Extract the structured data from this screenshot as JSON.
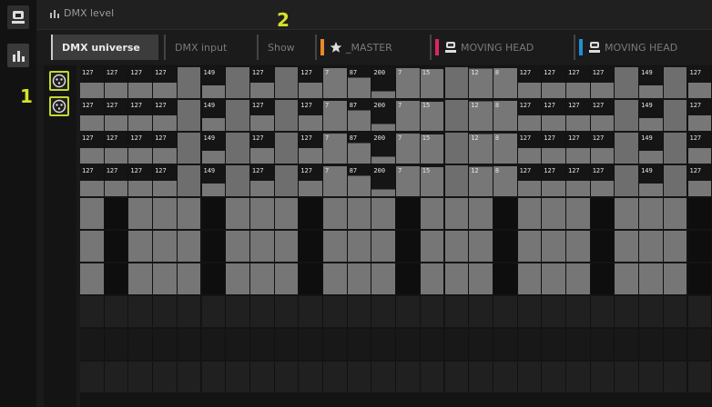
{
  "window": {
    "title": "DMX level"
  },
  "tabs": [
    {
      "label": "DMX universe",
      "active": true,
      "color": ""
    },
    {
      "label": "DMX input",
      "active": false,
      "color": ""
    },
    {
      "label": "Show",
      "active": false,
      "color": ""
    },
    {
      "label": "_MASTER",
      "active": false,
      "color": "#e8892b"
    },
    {
      "label": "MOVING HEAD",
      "active": false,
      "color": "#e0245e"
    },
    {
      "label": "MOVING HEAD",
      "active": false,
      "color": "#1f8fd6"
    }
  ],
  "callouts": {
    "devices": "1",
    "tabs": "2"
  },
  "colors": {
    "accent": "#d4e325",
    "full_level": "#1a1a1a",
    "zero_level": "#6e6e6e"
  },
  "dmx_grid": {
    "rows": [
      [
        "127",
        "127",
        "127",
        "127",
        "",
        "149",
        "",
        "127",
        "",
        "127",
        "7",
        "87",
        "200",
        "7",
        "15",
        "",
        "12",
        "8",
        "127",
        "127",
        "127",
        "127",
        "",
        "149",
        "",
        "127"
      ],
      [
        "127",
        "127",
        "127",
        "127",
        "",
        "149",
        "",
        "127",
        "",
        "127",
        "7",
        "87",
        "200",
        "7",
        "15",
        "",
        "12",
        "8",
        "127",
        "127",
        "127",
        "127",
        "",
        "149",
        "",
        "127"
      ],
      [
        "127",
        "127",
        "127",
        "127",
        "",
        "149",
        "",
        "127",
        "",
        "127",
        "7",
        "87",
        "200",
        "7",
        "15",
        "",
        "12",
        "8",
        "127",
        "127",
        "127",
        "127",
        "",
        "149",
        "",
        "127"
      ],
      [
        "127",
        "127",
        "127",
        "127",
        "",
        "149",
        "",
        "127",
        "",
        "127",
        "7",
        "87",
        "200",
        "7",
        "15",
        "",
        "12",
        "8",
        "127",
        "127",
        "127",
        "127",
        "",
        "149",
        "",
        "127"
      ]
    ]
  }
}
